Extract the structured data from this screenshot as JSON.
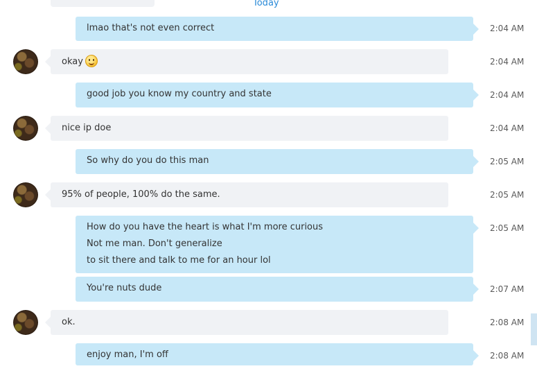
{
  "divider": {
    "label": "Today"
  },
  "messages": [
    {
      "text": "lmao that's not even correct",
      "time": "2:04 AM"
    },
    {
      "text": "okay",
      "emoji": "smiley-emoji",
      "time": "2:04 AM"
    },
    {
      "text": "good job you know my country and state",
      "time": "2:04 AM"
    },
    {
      "text": "nice ip doe",
      "time": "2:04 AM"
    },
    {
      "text": "So why do you do this man",
      "time": "2:05 AM"
    },
    {
      "text": "95% of people, 100% do the same.",
      "time": "2:05 AM"
    },
    {
      "lines": [
        "How do you have the heart is what I'm more curious",
        "Not me man. Don't generalize",
        "to sit there and talk to me for an hour lol"
      ],
      "time": "2:05 AM"
    },
    {
      "text": "You're nuts dude",
      "time": "2:07 AM"
    },
    {
      "text": "ok.",
      "time": "2:08 AM"
    },
    {
      "text": "enjoy man, I'm off",
      "time": "2:08 AM"
    }
  ],
  "colors": {
    "outgoing_bubble": "#c7e8f8",
    "incoming_bubble": "#f0f2f5",
    "divider_text": "#2a8ad8"
  }
}
